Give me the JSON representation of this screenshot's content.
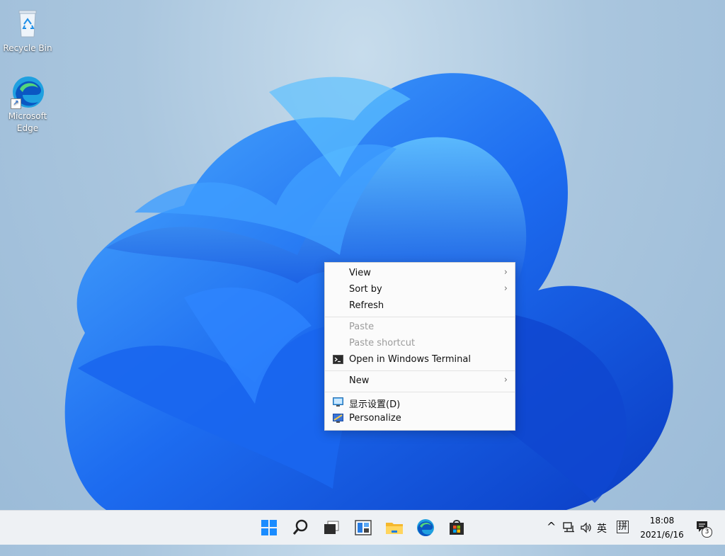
{
  "desktop": {
    "icons": [
      {
        "label": "Recycle Bin"
      },
      {
        "label_line1": "Microsoft",
        "label_line2": "Edge"
      }
    ]
  },
  "context_menu": {
    "items": {
      "view": "View",
      "sort_by": "Sort by",
      "refresh": "Refresh",
      "paste": "Paste",
      "paste_shortcut": "Paste shortcut",
      "open_terminal": "Open in Windows Terminal",
      "new": "New",
      "display_settings": "显示设置(D)",
      "personalize": "Personalize"
    },
    "submenu_arrow": "›"
  },
  "taskbar": {
    "tray": {
      "chevron": "^",
      "ime_lang": "英",
      "ime_mode": "拼",
      "time": "18:08",
      "date": "2021/6/16",
      "notification_count": "3"
    }
  }
}
